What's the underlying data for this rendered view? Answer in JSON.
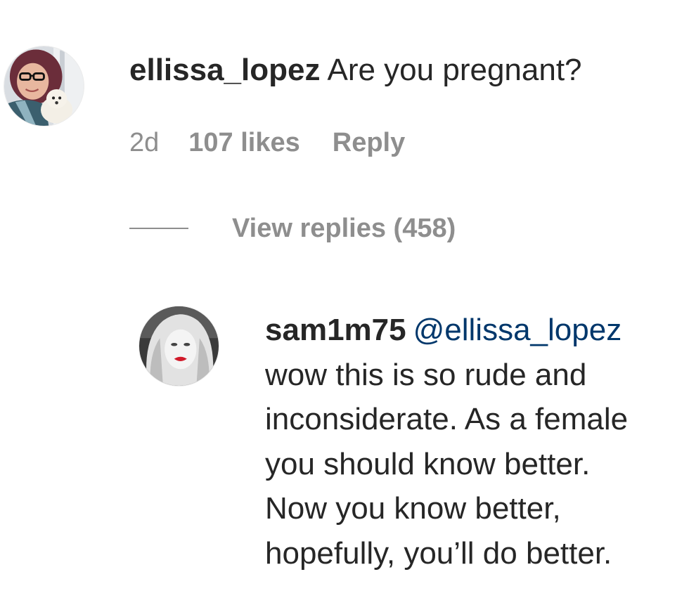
{
  "comment": {
    "username": "ellissa_lopez",
    "text": "Are you pregnant?",
    "time": "2d",
    "likes": "107 likes",
    "reply_label": "Reply",
    "view_replies_label": "View replies (458)",
    "avatar_icon": "profile-photo-woman-with-dog"
  },
  "reply": {
    "username": "sam1m75",
    "mention": "@ellissa_lopez",
    "lines": [
      "wow this is so rude and",
      "inconsiderate. As a female",
      "you should know better.",
      "Now you know better,",
      "hopefully, you’ll do better."
    ],
    "avatar_icon": "profile-photo-woman-red-lips"
  },
  "colors": {
    "text": "#262626",
    "secondary": "#8e8e8e",
    "mention": "#00376b"
  }
}
